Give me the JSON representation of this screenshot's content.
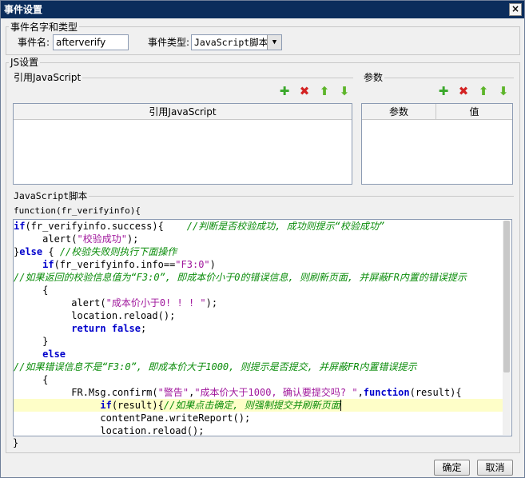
{
  "window": {
    "title": "事件设置",
    "close_glyph": "×"
  },
  "event_group": {
    "title": "事件名字和类型",
    "name_label": "事件名:",
    "name_value": "afterverify",
    "type_label": "事件类型:",
    "type_value": "JavaScript脚本"
  },
  "js_group": {
    "title": "JS设置"
  },
  "ref_js": {
    "section_title": "引用JavaScript",
    "column_header": "引用JavaScript",
    "toolbar_icons": [
      "add-icon",
      "delete-icon",
      "move-up-icon",
      "move-down-icon"
    ],
    "glyphs": {
      "add": "✚",
      "delete": "✖",
      "up": "⬆",
      "down": "⬇"
    },
    "rows": []
  },
  "params": {
    "section_title": "参数",
    "columns": [
      "参数",
      "值"
    ],
    "rows": []
  },
  "script": {
    "section_title": "JavaScript脚本",
    "function_header": "function(fr_verifyinfo){",
    "closing_brace": "}",
    "lines": [
      {
        "text": [
          {
            "t": "if",
            "k": "k"
          },
          {
            "t": "(fr_verifyinfo.success){    "
          },
          {
            "t": "//判断是否校验成功, 成功则提示“校验成功”",
            "k": "c"
          }
        ]
      },
      {
        "text": [
          {
            "t": "     alert("
          },
          {
            "t": "\"校验成功\"",
            "k": "s"
          },
          {
            "t": ");"
          }
        ]
      },
      {
        "text": [
          {
            "t": "}"
          },
          {
            "t": "else",
            "k": "k"
          },
          {
            "t": " { "
          },
          {
            "t": "//校验失败则执行下面操作",
            "k": "c"
          }
        ]
      },
      {
        "text": [
          {
            "t": "     "
          },
          {
            "t": "if",
            "k": "k"
          },
          {
            "t": "(fr_verifyinfo.info=="
          },
          {
            "t": "\"F3:0\"",
            "k": "s"
          },
          {
            "t": ")"
          }
        ]
      },
      {
        "text": [
          {
            "t": "//如果返回的校验信息值为“F3:0”, 即成本价小于0的错误信息, 则刷新页面, 并屏蔽FR内置的错误提示",
            "k": "c"
          }
        ]
      },
      {
        "text": [
          {
            "t": "     {"
          }
        ]
      },
      {
        "text": [
          {
            "t": "          alert("
          },
          {
            "t": "\"成本价小于0! ! ! \"",
            "k": "s"
          },
          {
            "t": ");"
          }
        ]
      },
      {
        "text": [
          {
            "t": "          location.reload();"
          }
        ]
      },
      {
        "text": [
          {
            "t": "          "
          },
          {
            "t": "return false",
            "k": "k"
          },
          {
            "t": ";"
          }
        ]
      },
      {
        "text": [
          {
            "t": "     }"
          }
        ]
      },
      {
        "text": [
          {
            "t": "     "
          },
          {
            "t": "else",
            "k": "k"
          }
        ]
      },
      {
        "text": [
          {
            "t": "//如果错误信息不是“F3:0”, 即成本价大于1000, 则提示是否提交, 并屏蔽FR内置错误提示",
            "k": "c"
          }
        ]
      },
      {
        "text": [
          {
            "t": "     {"
          }
        ]
      },
      {
        "text": [
          {
            "t": "          FR.Msg.confirm("
          },
          {
            "t": "\"警告\"",
            "k": "s"
          },
          {
            "t": ","
          },
          {
            "t": "\"成本价大于1000, 确认要提交吗? \"",
            "k": "s"
          },
          {
            "t": ","
          },
          {
            "t": "function",
            "k": "k"
          },
          {
            "t": "(result){"
          }
        ]
      },
      {
        "text": [
          {
            "t": "               "
          },
          {
            "t": "if",
            "k": "k"
          },
          {
            "t": "(result){"
          },
          {
            "t": "//如果点击确定, 则强制提交并刷新页面",
            "k": "c"
          }
        ],
        "highlight": true
      },
      {
        "text": [
          {
            "t": "               contentPane.writeReport();"
          }
        ]
      },
      {
        "text": [
          {
            "t": "               location.reload();"
          }
        ]
      }
    ]
  },
  "buttons": {
    "ok": "确定",
    "cancel": "取消"
  }
}
